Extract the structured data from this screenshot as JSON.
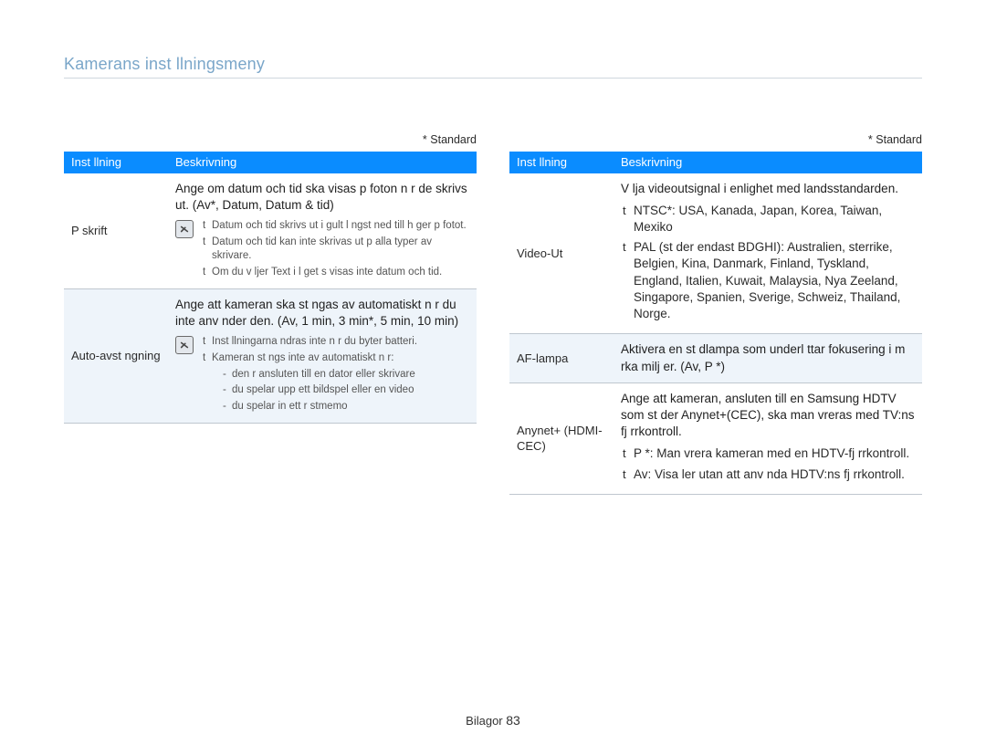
{
  "header": {
    "title": "Kamerans inst llningsmeny"
  },
  "left": {
    "standard_note": "* Standard",
    "thead": {
      "c1": "Inst llning",
      "c2": "Beskrivning"
    },
    "rows": [
      {
        "name": "P skrift",
        "desc": "Ange om datum och tid ska visas p  foton n r de skrivs ut. (Av*, Datum, Datum & tid)",
        "notes": [
          "Datum och tid skrivs ut i gult l ngst ned till h ger p  fotot.",
          "Datum och tid kan inte skrivas ut p  alla typer av skrivare.",
          "Om du v ljer Text i l get s  visas inte datum och tid."
        ]
      },
      {
        "name": "Auto-avst ngning",
        "desc": "Ange att kameran ska st ngas av automatiskt n r du inte anv nder den. (Av, 1 min, 3 min*, 5 min, 10 min)",
        "notes": [
          "Inst llningarna  ndras inte n r du byter batteri.",
          "Kameran st ngs inte av automatiskt n r:"
        ],
        "sub": [
          "den  r ansluten till en dator eller skrivare",
          "du spelar upp ett bildspel eller en video",
          "du spelar in ett r stmemo"
        ]
      }
    ]
  },
  "right": {
    "standard_note": "* Standard",
    "thead": {
      "c1": "Inst llning",
      "c2": "Beskrivning"
    },
    "rows": [
      {
        "name": "Video-Ut",
        "desc": "V lja videoutsignal i enlighet med landsstandarden.",
        "bullets": [
          "NTSC*: USA, Kanada, Japan, Korea, Taiwan, Mexiko",
          "PAL (st der endast BDGHI): Australien,  sterrike, Belgien, Kina, Danmark, Finland, Tyskland, England, Italien, Kuwait, Malaysia, Nya Zeeland, Singapore, Spanien, Sverige, Schweiz, Thailand, Norge."
        ]
      },
      {
        "name": "AF-lampa",
        "desc": "Aktivera en st dlampa som underl ttar fokusering i m rka milj er. (Av, P *)"
      },
      {
        "name": "Anynet+ (HDMI-CEC)",
        "desc": "Ange att kameran, ansluten till en Samsung HDTV som st der Anynet+(CEC), ska man vreras med TV:ns fj rrkontroll.",
        "bullets": [
          "P *: Man vrera kameran med en HDTV-fj rrkontroll.",
          "Av: Visa  ler utan att anv nda HDTV:ns fj rrkontroll."
        ]
      }
    ]
  },
  "footer": {
    "section": "Bilagor",
    "page": "83"
  }
}
